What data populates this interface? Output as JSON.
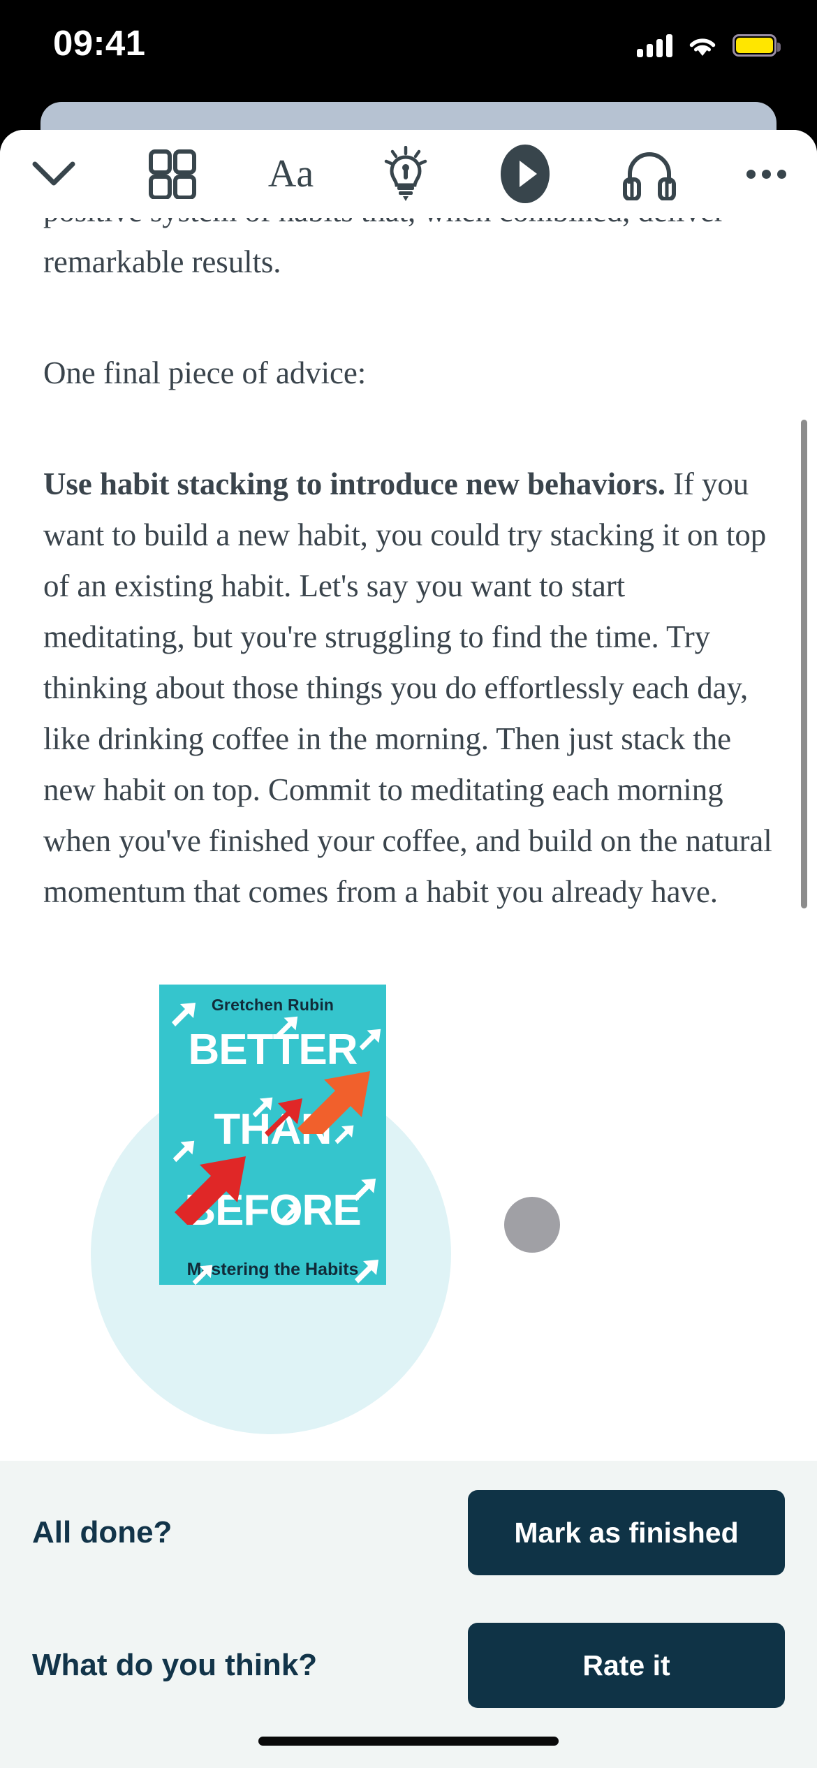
{
  "status_bar": {
    "time": "09:41",
    "signal_icon": "cellular-signal-icon",
    "wifi_icon": "wifi-icon",
    "battery_icon": "battery-icon",
    "battery_color": "#FFE600"
  },
  "toolbar": {
    "collapse_label": "∨",
    "items": [
      {
        "name": "chevron-down-icon",
        "label": "Close reader"
      },
      {
        "name": "grid-icon",
        "label": "Chapters"
      },
      {
        "name": "text-size-icon",
        "label": "Aa"
      },
      {
        "name": "lightbulb-icon",
        "label": "Insights"
      },
      {
        "name": "play-icon",
        "label": "Play"
      },
      {
        "name": "headphones-icon",
        "label": "Audio"
      },
      {
        "name": "more-icon",
        "label": "More"
      }
    ]
  },
  "reader": {
    "clipped_line": "positive system of habits that, when combined, deliver",
    "para_1": "remarkable results.",
    "para_2": "One final piece of advice:",
    "para_3_bold": "Use habit stacking to introduce new behaviors.",
    "para_3_rest": " If you want to build a new habit, you could try stacking it on top of an existing habit. Let's say you want to start meditating, but you're struggling to find the time. Try thinking about those things you do effortlessly each day, like drinking coffee in the morning. Then just stack the new habit on top. Commit to meditating each morning when you've finished your coffee, and build on the natural momentum that comes from a habit you already have."
  },
  "book_cover": {
    "author": "Gretchen Rubin",
    "title_line_1": "BETTER",
    "title_line_2": "THAN",
    "title_line_3": "BEFORE",
    "subtitle": "Mastering the Habits",
    "background_color": "#35c5cd",
    "accent_orange": "#f1602c",
    "accent_red": "#e02727"
  },
  "action_panel": {
    "rows": [
      {
        "label": "All done?",
        "button": "Mark as finished"
      },
      {
        "label": "What do you think?",
        "button": "Rate it"
      }
    ],
    "button_color": "#0f3346",
    "panel_color": "#f1f5f4"
  }
}
